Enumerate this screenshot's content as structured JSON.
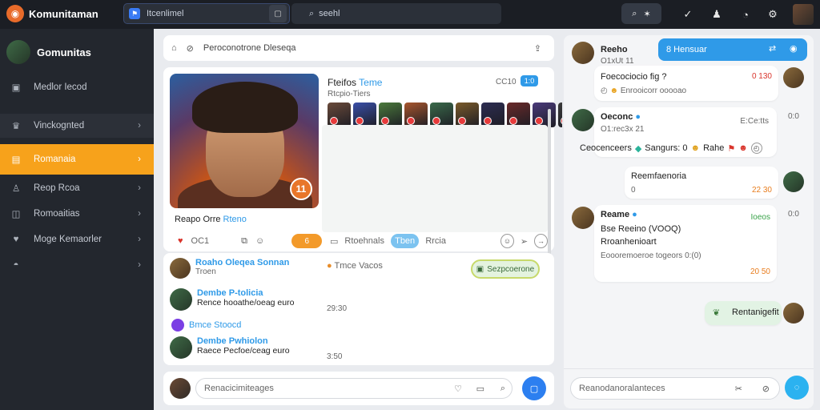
{
  "app": {
    "title": "Komunitaman"
  },
  "topbar": {
    "search1_text": "Itcenlimel",
    "search2_text": "seehl"
  },
  "sidebar": {
    "header": "Gomunitas",
    "items": [
      {
        "label": "Medlor Iecod"
      },
      {
        "label": "Vinckognted"
      },
      {
        "label": "Romanaia"
      },
      {
        "label": "Reop Rcoa"
      },
      {
        "label": "Romoaitias"
      },
      {
        "label": "Moge Kemaorler"
      }
    ]
  },
  "main": {
    "toolbar_text": "Peroconotrone Dleseqa",
    "hero_caption": {
      "name": "Reapo Orre",
      "tag": "Rteno"
    },
    "hero_badge": "11",
    "hero_actions": {
      "count": "OC1",
      "pill": "6"
    },
    "post": {
      "title": "Fteifos",
      "title_tag": "Teme",
      "sub": "Rtcpio-Tiers",
      "time": "CC10",
      "badge": "1:0"
    },
    "thumbs": [
      "#6a4a3a",
      "#3a4fa8",
      "#4b7a3c",
      "#a8562e",
      "#3a6a4a",
      "#7a5a2a",
      "#2d2d52",
      "#6a2a2a",
      "#4a3a7a",
      "#3a3a3a",
      "#a53a3a"
    ],
    "tabs": {
      "left": "Rtoehnals",
      "active": "Tben",
      "right": "Rrcia"
    },
    "feed": [
      {
        "title": "Roaho Oleqea Sonnan",
        "sub": "Troen",
        "right": "Tmce Vacos"
      },
      {
        "title": "Dembe P-tolicia",
        "sub": "Rence hooathe/oeag euro",
        "time": "29:30",
        "link": "Bmce Stoocd"
      },
      {
        "title": "Dembe Pwhiolon",
        "sub": "Raece Pecfoe/ceag euro",
        "time": "3:50"
      }
    ],
    "feed_pill": "Sezpcoerone",
    "composer_placeholder": "Renacicimiteages"
  },
  "right": {
    "header_pill": "8 Hensuar",
    "messages": [
      {
        "name": "Reeho",
        "handle": "O1xUt 11",
        "text": "Foecociocio fig ?",
        "stat": "0 130",
        "sub": "Enrooicorr ooooao"
      },
      {
        "name": "Oeconc",
        "handle": "O1:rec3x 21",
        "stat": "E:Ce:tts",
        "text": "Ceocenceers",
        "text2": "Sangurs: 0",
        "text3": "Rahe",
        "count": "0:0"
      },
      {
        "name": "Reemfaenoria",
        "sub": "0",
        "stat": "22 30"
      },
      {
        "name": "Reame",
        "stat": "Ioeos",
        "line1": "Bse Reeino (VOOQ)",
        "line2": "Rroanhenioart",
        "line3": "Eoooremoeroe togeors 0:(0)",
        "stat2": "20 50",
        "count": "0:0"
      },
      {
        "name": "Rentanigefit"
      }
    ],
    "composer_placeholder": "Reanodanoralanteces"
  }
}
